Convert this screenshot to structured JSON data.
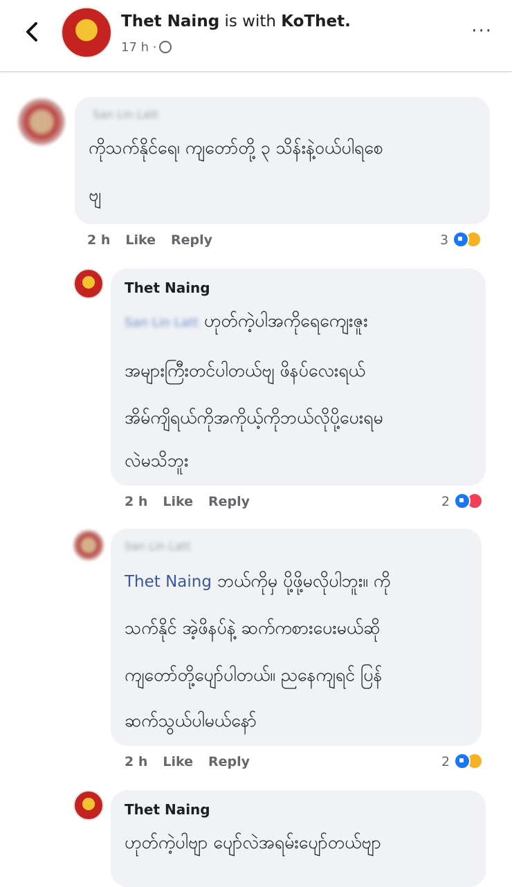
{
  "header": {
    "author": "Thet Naing",
    "with_text": "is with",
    "tagged": "KoThet.",
    "time": "17 h ·",
    "more": "···"
  },
  "comments": [
    {
      "name": "San Lin Latt",
      "lines": [
        "ကိုသက်နိုင်ရေ၊ ကျတော်တို့ ၃ သိန်းနဲ့ဝယ်ပါရစေ",
        "ဗျ"
      ],
      "time": "2 h",
      "like": "Like",
      "reply": "Reply",
      "reactions": "3"
    },
    {
      "name": "Thet Naing",
      "mention": "San Lin Latt",
      "lines": [
        "ဟုတ်ကဲ့ပါအကိုရေကျေးဇူး",
        "အများကြီးတင်ပါတယ်ဗျ ဖိနပ်လေးရယ်",
        "အိမ်ကျိရယ်ကိုအကိုယ့်ကိုဘယ်လိုပို့ပေးရမ",
        "လဲမသိဘူး"
      ],
      "time": "2 h",
      "like": "Like",
      "reply": "Reply",
      "reactions": "2"
    },
    {
      "name": "San Lin Latt",
      "mention": "Thet Naing",
      "lines": [
        "ဘယ်ကိုမှ ပို့ဖို့မလိုပါဘူး။ ကို",
        "သက်နိုင် အဲ့ဖိနပ်နဲ့ ဆက်ကစားပေးမယ်ဆို",
        "ကျတော်တို့ပျော်ပါတယ်။ ညနေကျရင် ပြန်",
        "ဆက်သွယ်ပါမယ်နော်"
      ],
      "time": "2 h",
      "like": "Like",
      "reply": "Reply",
      "reactions": "2"
    },
    {
      "name": "Thet Naing",
      "lines": [
        "ဟုတ်ကဲ့ပါဗျာ ပျော်လဲအရမ်းပျော်တယ်ဗျာ"
      ]
    }
  ]
}
